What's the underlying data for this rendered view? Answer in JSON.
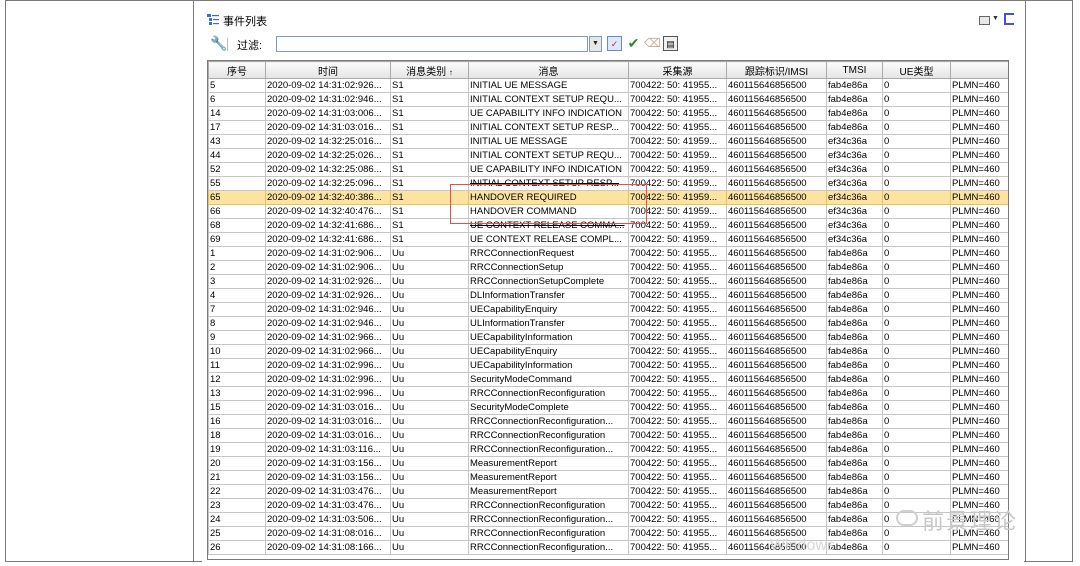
{
  "window": {
    "title": "事件列表",
    "filter_label": "过滤:",
    "filter_value": ""
  },
  "grid": {
    "columns": [
      "序号",
      "时间",
      "消息类别",
      "消息",
      "采集源",
      "跟踪标识/IMSI",
      "TMSI",
      "UE类型",
      ""
    ],
    "sort_indicator": "↑",
    "rows": [
      [
        "5",
        "2020-09-02 14:31:02:926...",
        "S1",
        "INITIAL UE MESSAGE",
        "700422: 50: 41955...",
        "460115646856500",
        "fab4e86a",
        "0",
        "PLMN=460"
      ],
      [
        "6",
        "2020-09-02 14:31:02:946...",
        "S1",
        "INITIAL CONTEXT SETUP REQU...",
        "700422: 50: 41955...",
        "460115646856500",
        "fab4e86a",
        "0",
        "PLMN=460"
      ],
      [
        "14",
        "2020-09-02 14:31:03:006...",
        "S1",
        "UE CAPABILITY INFO INDICATION",
        "700422: 50: 41955...",
        "460115646856500",
        "fab4e86a",
        "0",
        "PLMN=460"
      ],
      [
        "17",
        "2020-09-02 14:31:03:016...",
        "S1",
        "INITIAL CONTEXT SETUP RESP...",
        "700422: 50: 41955...",
        "460115646856500",
        "fab4e86a",
        "0",
        "PLMN=460"
      ],
      [
        "43",
        "2020-09-02 14:32:25:016...",
        "S1",
        "INITIAL UE MESSAGE",
        "700422: 50: 41959...",
        "460115646856500",
        "ef34c36a",
        "0",
        "PLMN=460"
      ],
      [
        "44",
        "2020-09-02 14:32:25:026...",
        "S1",
        "INITIAL CONTEXT SETUP REQU...",
        "700422: 50: 41959...",
        "460115646856500",
        "ef34c36a",
        "0",
        "PLMN=460"
      ],
      [
        "52",
        "2020-09-02 14:32:25:086...",
        "S1",
        "UE CAPABILITY INFO INDICATION",
        "700422: 50: 41959...",
        "460115646856500",
        "ef34c36a",
        "0",
        "PLMN=460"
      ],
      [
        "55",
        "2020-09-02 14:32:25:096...",
        "S1",
        "INITIAL CONTEXT SETUP RESP...",
        "700422: 50: 41959...",
        "460115646856500",
        "ef34c36a",
        "0",
        "PLMN=460"
      ],
      [
        "65",
        "2020-09-02 14:32:40:386...",
        "S1",
        "HANDOVER REQUIRED",
        "700422: 50: 41959...",
        "460115646856500",
        "ef34c36a",
        "0",
        "PLMN=460"
      ],
      [
        "66",
        "2020-09-02 14:32:40:476...",
        "S1",
        "HANDOVER COMMAND",
        "700422: 50: 41959...",
        "460115646856500",
        "ef34c36a",
        "0",
        "PLMN=460"
      ],
      [
        "68",
        "2020-09-02 14:32:41:686...",
        "S1",
        "UE CONTEXT RELEASE COMMA...",
        "700422: 50: 41959...",
        "460115646856500",
        "ef34c36a",
        "0",
        "PLMN=460"
      ],
      [
        "69",
        "2020-09-02 14:32:41:686...",
        "S1",
        "UE CONTEXT RELEASE COMPL...",
        "700422: 50: 41959...",
        "460115646856500",
        "ef34c36a",
        "0",
        "PLMN=460"
      ],
      [
        "1",
        "2020-09-02 14:31:02:906...",
        "Uu",
        "RRCConnectionRequest",
        "700422: 50: 41955...",
        "460115646856500",
        "fab4e86a",
        "0",
        "PLMN=460"
      ],
      [
        "2",
        "2020-09-02 14:31:02:906...",
        "Uu",
        "RRCConnectionSetup",
        "700422: 50: 41955...",
        "460115646856500",
        "fab4e86a",
        "0",
        "PLMN=460"
      ],
      [
        "3",
        "2020-09-02 14:31:02:926...",
        "Uu",
        "RRCConnectionSetupComplete",
        "700422: 50: 41955...",
        "460115646856500",
        "fab4e86a",
        "0",
        "PLMN=460"
      ],
      [
        "4",
        "2020-09-02 14:31:02:926...",
        "Uu",
        "DLInformationTransfer",
        "700422: 50: 41955...",
        "460115646856500",
        "fab4e86a",
        "0",
        "PLMN=460"
      ],
      [
        "7",
        "2020-09-02 14:31:02:946...",
        "Uu",
        "UECapabilityEnquiry",
        "700422: 50: 41955...",
        "460115646856500",
        "fab4e86a",
        "0",
        "PLMN=460"
      ],
      [
        "8",
        "2020-09-02 14:31:02:946...",
        "Uu",
        "ULInformationTransfer",
        "700422: 50: 41955...",
        "460115646856500",
        "fab4e86a",
        "0",
        "PLMN=460"
      ],
      [
        "9",
        "2020-09-02 14:31:02:966...",
        "Uu",
        "UECapabilityInformation",
        "700422: 50: 41955...",
        "460115646856500",
        "fab4e86a",
        "0",
        "PLMN=460"
      ],
      [
        "10",
        "2020-09-02 14:31:02:966...",
        "Uu",
        "UECapabilityEnquiry",
        "700422: 50: 41955...",
        "460115646856500",
        "fab4e86a",
        "0",
        "PLMN=460"
      ],
      [
        "11",
        "2020-09-02 14:31:02:996...",
        "Uu",
        "UECapabilityInformation",
        "700422: 50: 41955...",
        "460115646856500",
        "fab4e86a",
        "0",
        "PLMN=460"
      ],
      [
        "12",
        "2020-09-02 14:31:02:996...",
        "Uu",
        "SecurityModeCommand",
        "700422: 50: 41955...",
        "460115646856500",
        "fab4e86a",
        "0",
        "PLMN=460"
      ],
      [
        "13",
        "2020-09-02 14:31:02:996...",
        "Uu",
        "RRCConnectionReconfiguration",
        "700422: 50: 41955...",
        "460115646856500",
        "fab4e86a",
        "0",
        "PLMN=460"
      ],
      [
        "15",
        "2020-09-02 14:31:03:016...",
        "Uu",
        "SecurityModeComplete",
        "700422: 50: 41955...",
        "460115646856500",
        "fab4e86a",
        "0",
        "PLMN=460"
      ],
      [
        "16",
        "2020-09-02 14:31:03:016...",
        "Uu",
        "RRCConnectionReconfiguration...",
        "700422: 50: 41955...",
        "460115646856500",
        "fab4e86a",
        "0",
        "PLMN=460"
      ],
      [
        "18",
        "2020-09-02 14:31:03:016...",
        "Uu",
        "RRCConnectionReconfiguration",
        "700422: 50: 41955...",
        "460115646856500",
        "fab4e86a",
        "0",
        "PLMN=460"
      ],
      [
        "19",
        "2020-09-02 14:31:03:116...",
        "Uu",
        "RRCConnectionReconfiguration...",
        "700422: 50: 41955...",
        "460115646856500",
        "fab4e86a",
        "0",
        "PLMN=460"
      ],
      [
        "20",
        "2020-09-02 14:31:03:156...",
        "Uu",
        "MeasurementReport",
        "700422: 50: 41955...",
        "460115646856500",
        "fab4e86a",
        "0",
        "PLMN=460"
      ],
      [
        "21",
        "2020-09-02 14:31:03:156...",
        "Uu",
        "MeasurementReport",
        "700422: 50: 41955...",
        "460115646856500",
        "fab4e86a",
        "0",
        "PLMN=460"
      ],
      [
        "22",
        "2020-09-02 14:31:03:476...",
        "Uu",
        "MeasurementReport",
        "700422: 50: 41955...",
        "460115646856500",
        "fab4e86a",
        "0",
        "PLMN=460"
      ],
      [
        "23",
        "2020-09-02 14:31:03:476...",
        "Uu",
        "RRCConnectionReconfiguration",
        "700422: 50: 41955...",
        "460115646856500",
        "fab4e86a",
        "0",
        "PLMN=460"
      ],
      [
        "24",
        "2020-09-02 14:31:03:506...",
        "Uu",
        "RRCConnectionReconfiguration...",
        "700422: 50: 41955...",
        "460115646856500",
        "fab4e86a",
        "0",
        "PLMN=460"
      ],
      [
        "25",
        "2020-09-02 14:31:08:016...",
        "Uu",
        "RRCConnectionReconfiguration",
        "700422: 50: 41955...",
        "460115646856500",
        "fab4e86a",
        "0",
        "PLMN=460"
      ],
      [
        "26",
        "2020-09-02 14:31:08:166...",
        "Uu",
        "RRCConnectionReconfiguration...",
        "700422: 50: 41955...",
        "460115646856500",
        "fab4e86a",
        "0",
        "PLMN=460"
      ]
    ],
    "selected_row_index": 8,
    "strikethrough_row_indices": [
      7,
      10
    ]
  },
  "watermark": {
    "text": "前景理论",
    "windows_text": "Windows"
  },
  "colors": {
    "selected_row": "#fde3a0",
    "highlight_box": "#e25050"
  },
  "icons": {
    "title": "event-list-icon",
    "wrench": "wrench-icon",
    "filter_apply": "filter-apply-icon",
    "check": "check-icon",
    "clear": "eraser-icon",
    "save": "save-icon",
    "layout": "column-layout-icon"
  }
}
